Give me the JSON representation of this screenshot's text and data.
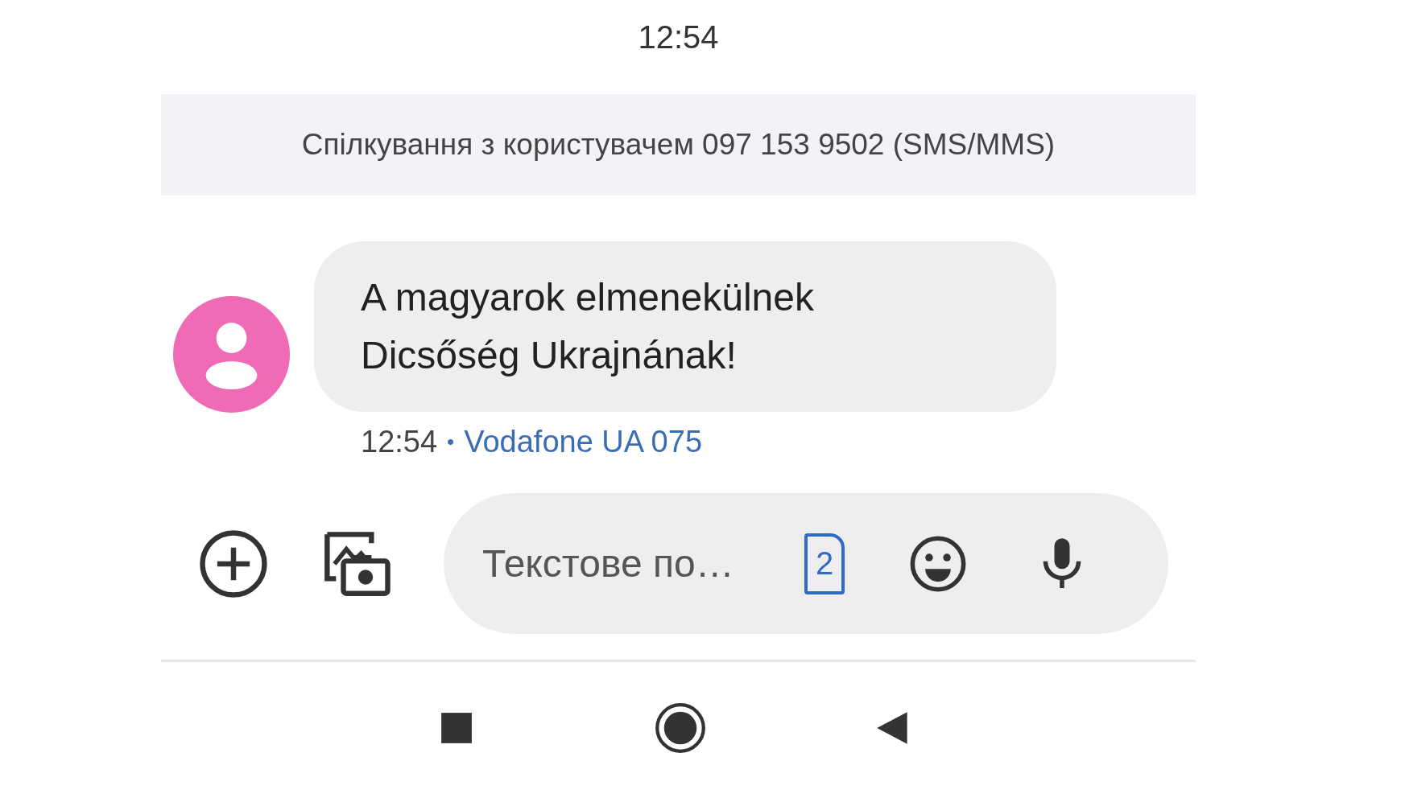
{
  "status_bar": {
    "time": "12:54"
  },
  "conversation_banner": {
    "text": "Спілкування з користувачем 097 153 9502 (SMS/MMS)"
  },
  "messages": [
    {
      "lines": [
        "A magyarok elmenekülnek",
        "Dicsőség Ukrajnának!"
      ],
      "time": "12:54",
      "separator": "•",
      "carrier": "Vodafone UA 075"
    }
  ],
  "compose": {
    "placeholder": "Текстове по…",
    "sim_number": "2"
  }
}
